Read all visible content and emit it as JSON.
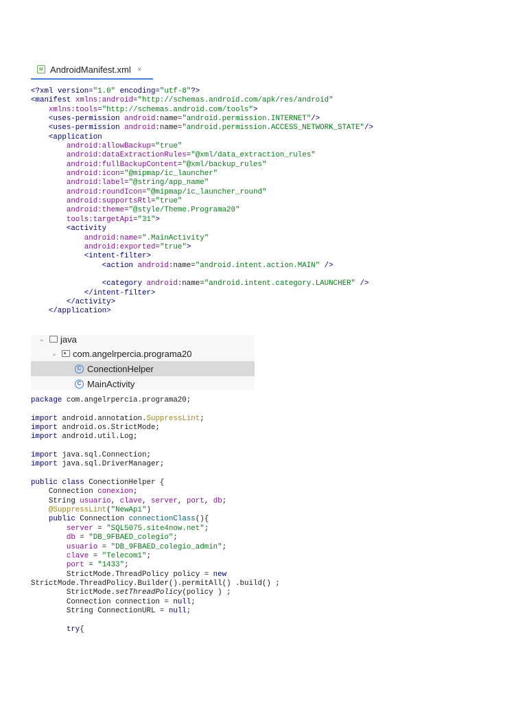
{
  "tab": {
    "title": "AndroidManifest.xml",
    "icon": "xml-file-icon",
    "close": "×"
  },
  "xml_code": [
    [
      [
        "<?xml version=",
        "tg"
      ],
      [
        "\"1.0\"",
        "st"
      ],
      [
        " encoding=",
        "tg"
      ],
      [
        "\"utf-8\"",
        "st"
      ],
      [
        "?>",
        "tg"
      ]
    ],
    [
      [
        "<manifest ",
        "tg"
      ],
      [
        "xmlns:android",
        "ns"
      ],
      [
        "=",
        ""
      ],
      [
        "\"http://schemas.android.com/apk/res/android\"",
        "st"
      ]
    ],
    [
      [
        "    ",
        ""
      ],
      [
        "xmlns:tools",
        "ns"
      ],
      [
        "=",
        ""
      ],
      [
        "\"http://schemas.android.com/tools\"",
        "st"
      ],
      [
        ">",
        "tg"
      ]
    ],
    [
      [
        "    <uses-permission ",
        "tg"
      ],
      [
        "android",
        "ns"
      ],
      [
        ":name",
        ""
      ],
      [
        "=",
        ""
      ],
      [
        "\"android.permission.INTERNET\"",
        "st"
      ],
      [
        "/>",
        "tg"
      ]
    ],
    [
      [
        "    <uses-permission ",
        "tg"
      ],
      [
        "android",
        "ns"
      ],
      [
        ":name",
        ""
      ],
      [
        "=",
        ""
      ],
      [
        "\"android.permission.ACCESS_NETWORK_STATE\"",
        "st"
      ],
      [
        "/>",
        "tg"
      ]
    ],
    [
      [
        "    <application",
        "tg"
      ]
    ],
    [
      [
        "        ",
        ""
      ],
      [
        "android",
        "ns"
      ],
      [
        ":allowBackup",
        "ns"
      ],
      [
        "=",
        ""
      ],
      [
        "\"true\"",
        "st"
      ]
    ],
    [
      [
        "        ",
        ""
      ],
      [
        "android",
        "ns"
      ],
      [
        ":dataExtractionRules",
        "ns"
      ],
      [
        "=",
        ""
      ],
      [
        "\"@xml/data_extraction_rules\"",
        "st"
      ]
    ],
    [
      [
        "        ",
        ""
      ],
      [
        "android",
        "ns"
      ],
      [
        ":fullBackupContent",
        "ns"
      ],
      [
        "=",
        ""
      ],
      [
        "\"@xml/backup_rules\"",
        "st"
      ]
    ],
    [
      [
        "        ",
        ""
      ],
      [
        "android",
        "ns"
      ],
      [
        ":icon",
        "ns"
      ],
      [
        "=",
        ""
      ],
      [
        "\"@mipmap/ic_launcher\"",
        "st"
      ]
    ],
    [
      [
        "        ",
        ""
      ],
      [
        "android",
        "ns"
      ],
      [
        ":label",
        "ns"
      ],
      [
        "=",
        ""
      ],
      [
        "\"@string/app_name\"",
        "st"
      ]
    ],
    [
      [
        "        ",
        ""
      ],
      [
        "android",
        "ns"
      ],
      [
        ":roundIcon",
        "ns"
      ],
      [
        "=",
        ""
      ],
      [
        "\"@mipmap/ic_launcher_round\"",
        "st"
      ]
    ],
    [
      [
        "        ",
        ""
      ],
      [
        "android",
        "ns"
      ],
      [
        ":supportsRtl",
        "ns"
      ],
      [
        "=",
        ""
      ],
      [
        "\"true\"",
        "st"
      ]
    ],
    [
      [
        "        ",
        ""
      ],
      [
        "android",
        "ns"
      ],
      [
        ":theme",
        "ns"
      ],
      [
        "=",
        ""
      ],
      [
        "\"@style/Theme.Programa20\"",
        "st"
      ]
    ],
    [
      [
        "        ",
        ""
      ],
      [
        "tools",
        "ns"
      ],
      [
        ":targetApi",
        "ns"
      ],
      [
        "=",
        ""
      ],
      [
        "\"31\"",
        "st"
      ],
      [
        ">",
        "tg"
      ]
    ],
    [
      [
        "        <activity",
        "tg"
      ]
    ],
    [
      [
        "            ",
        ""
      ],
      [
        "android",
        "ns"
      ],
      [
        ":name",
        "ns"
      ],
      [
        "=",
        ""
      ],
      [
        "\".MainActivity\"",
        "st"
      ]
    ],
    [
      [
        "            ",
        ""
      ],
      [
        "android",
        "ns"
      ],
      [
        ":exported",
        "ns"
      ],
      [
        "=",
        ""
      ],
      [
        "\"true\"",
        "st"
      ],
      [
        ">",
        "tg"
      ]
    ],
    [
      [
        "            <intent-filter>",
        "tg"
      ]
    ],
    [
      [
        "                <action ",
        "tg"
      ],
      [
        "android",
        "ns"
      ],
      [
        ":name",
        ""
      ],
      [
        "=",
        ""
      ],
      [
        "\"android.intent.action.MAIN\"",
        "st"
      ],
      [
        " />",
        "tg"
      ]
    ],
    [
      [
        "",
        ""
      ]
    ],
    [
      [
        "                <category ",
        "tg"
      ],
      [
        "android",
        "ns"
      ],
      [
        ":name",
        ""
      ],
      [
        "=",
        ""
      ],
      [
        "\"android.intent.category.LAUNCHER\"",
        "st"
      ],
      [
        " />",
        "tg"
      ]
    ],
    [
      [
        "            </intent-filter>",
        "tg"
      ]
    ],
    [
      [
        "        </activity>",
        "tg"
      ]
    ],
    [
      [
        "    </application>",
        "tg"
      ]
    ]
  ],
  "tree": [
    {
      "chevron": "⌄",
      "icon": "folder-icon",
      "label": "java",
      "selected": false
    },
    {
      "chevron": "⌄",
      "icon": "package-icon",
      "label": "com.angelrpercia.programa20",
      "selected": false
    },
    {
      "chevron": "",
      "icon": "class-icon",
      "label": "ConectionHelper",
      "selected": true
    },
    {
      "chevron": "",
      "icon": "class-icon",
      "label": "MainActivity",
      "selected": false
    }
  ],
  "java_code": [
    [
      [
        "package",
        "tg"
      ],
      [
        " com.angelrpercia.programa20;",
        ""
      ]
    ],
    [
      [
        "",
        ""
      ]
    ],
    [
      [
        "import",
        "tg"
      ],
      [
        " android.annotation.",
        ""
      ],
      [
        "SuppressLint",
        "an"
      ],
      [
        ";",
        ""
      ]
    ],
    [
      [
        "import",
        "tg"
      ],
      [
        " android.os.StrictMode;",
        ""
      ]
    ],
    [
      [
        "import",
        "tg"
      ],
      [
        " android.util.Log;",
        ""
      ]
    ],
    [
      [
        "",
        ""
      ]
    ],
    [
      [
        "import",
        "tg"
      ],
      [
        " java.sql.Connection;",
        ""
      ]
    ],
    [
      [
        "import",
        "tg"
      ],
      [
        " java.sql.DriverManager;",
        ""
      ]
    ],
    [
      [
        "",
        ""
      ]
    ],
    [
      [
        "public class",
        "tg"
      ],
      [
        " ConectionHelper {",
        ""
      ]
    ],
    [
      [
        "    Connection ",
        ""
      ],
      [
        "conexion",
        "fd"
      ],
      [
        ";",
        ""
      ]
    ],
    [
      [
        "    String ",
        ""
      ],
      [
        "usuario",
        "fd"
      ],
      [
        ", ",
        ""
      ],
      [
        "clave",
        "fd"
      ],
      [
        ", ",
        ""
      ],
      [
        "server",
        "fd"
      ],
      [
        ", ",
        ""
      ],
      [
        "port",
        "fd"
      ],
      [
        ", ",
        ""
      ],
      [
        "db",
        "fd"
      ],
      [
        ";",
        ""
      ]
    ],
    [
      [
        "    ",
        ""
      ],
      [
        "@SuppressLint",
        "an"
      ],
      [
        "(",
        ""
      ],
      [
        "\"NewApi\"",
        "st"
      ],
      [
        ")",
        ""
      ]
    ],
    [
      [
        "    ",
        ""
      ],
      [
        "public",
        "tg"
      ],
      [
        " Connection ",
        ""
      ],
      [
        "connectionClass",
        "mt"
      ],
      [
        "(){",
        ""
      ]
    ],
    [
      [
        "        ",
        ""
      ],
      [
        "server",
        "fd"
      ],
      [
        " = ",
        ""
      ],
      [
        "\"SQL5075.site4now.net\"",
        "st"
      ],
      [
        ";",
        ""
      ]
    ],
    [
      [
        "        ",
        ""
      ],
      [
        "db",
        "fd"
      ],
      [
        " = ",
        ""
      ],
      [
        "\"DB_9FBAED_colegio\"",
        "st"
      ],
      [
        ";",
        ""
      ]
    ],
    [
      [
        "        ",
        ""
      ],
      [
        "usuario",
        "fd"
      ],
      [
        " = ",
        ""
      ],
      [
        "\"DB_9FBAED_colegio_admin\"",
        "st"
      ],
      [
        ";",
        ""
      ]
    ],
    [
      [
        "        ",
        ""
      ],
      [
        "clave",
        "fd"
      ],
      [
        " = ",
        ""
      ],
      [
        "\"Telecom1\"",
        "st"
      ],
      [
        ";",
        ""
      ]
    ],
    [
      [
        "        ",
        ""
      ],
      [
        "port",
        "fd"
      ],
      [
        " = ",
        ""
      ],
      [
        "\"1433\"",
        "st"
      ],
      [
        ";",
        ""
      ]
    ],
    [
      [
        "        StrictMode.ThreadPolicy policy = ",
        ""
      ],
      [
        "new",
        "tg"
      ]
    ],
    [
      [
        "StrictMode.ThreadPolicy.Builder().permitAll() .build() ;",
        ""
      ]
    ],
    [
      [
        "        StrictMode.",
        ""
      ],
      [
        "setThreadPolicy",
        "it"
      ],
      [
        "(policy ) ;",
        ""
      ]
    ],
    [
      [
        "        Connection connection = ",
        ""
      ],
      [
        "null",
        "tg"
      ],
      [
        ";",
        ""
      ]
    ],
    [
      [
        "        String ConnectionURL = ",
        ""
      ],
      [
        "null",
        "tg"
      ],
      [
        ";",
        ""
      ]
    ],
    [
      [
        "",
        ""
      ]
    ],
    [
      [
        "        ",
        ""
      ],
      [
        "try",
        "tg"
      ],
      [
        "{",
        ""
      ]
    ]
  ]
}
